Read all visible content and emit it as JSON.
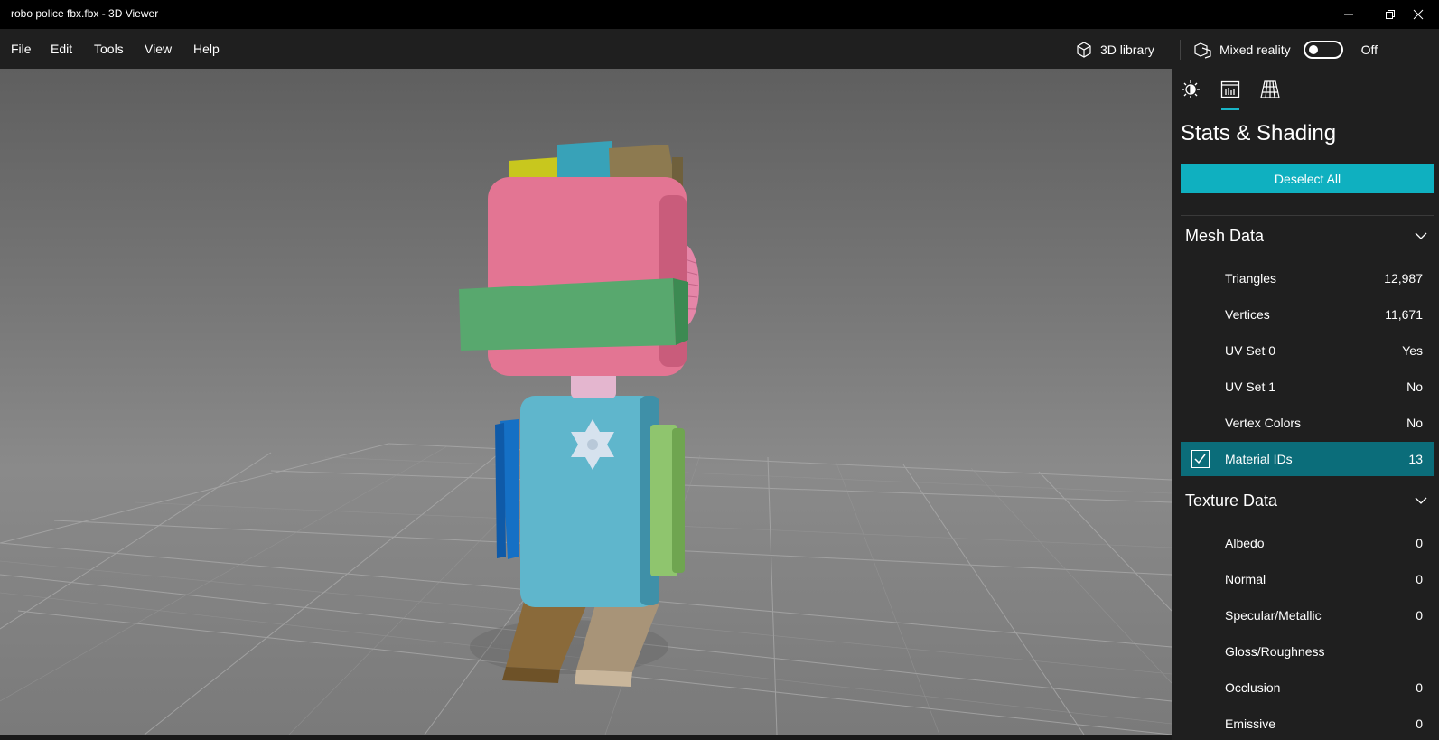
{
  "window": {
    "title": "robo police fbx.fbx - 3D Viewer"
  },
  "menu": {
    "file": "File",
    "edit": "Edit",
    "tools": "Tools",
    "view": "View",
    "help": "Help"
  },
  "toolbar": {
    "library_label": "3D library",
    "mixed_reality_label": "Mixed reality",
    "toggle_state": "Off"
  },
  "panel": {
    "title": "Stats & Shading",
    "deselect_label": "Deselect All",
    "mesh_section": {
      "label": "Mesh Data",
      "rows": [
        {
          "label": "Triangles",
          "value": "12,987"
        },
        {
          "label": "Vertices",
          "value": "11,671"
        },
        {
          "label": "UV Set 0",
          "value": "Yes"
        },
        {
          "label": "UV Set 1",
          "value": "No"
        },
        {
          "label": "Vertex Colors",
          "value": "No"
        },
        {
          "label": "Material IDs",
          "value": "13"
        }
      ]
    },
    "texture_section": {
      "label": "Texture Data",
      "rows": [
        {
          "label": "Albedo",
          "value": "0"
        },
        {
          "label": "Normal",
          "value": "0"
        },
        {
          "label": "Specular/Metallic",
          "value": "0"
        },
        {
          "label": "Gloss/Roughness",
          "value": ""
        },
        {
          "label": "Occlusion",
          "value": "0"
        },
        {
          "label": "Emissive",
          "value": "0"
        }
      ]
    }
  },
  "colors": {
    "accent": "#0fb0c0",
    "selected_row": "#0b6d7a",
    "panel_bg": "#1f1f1f"
  }
}
